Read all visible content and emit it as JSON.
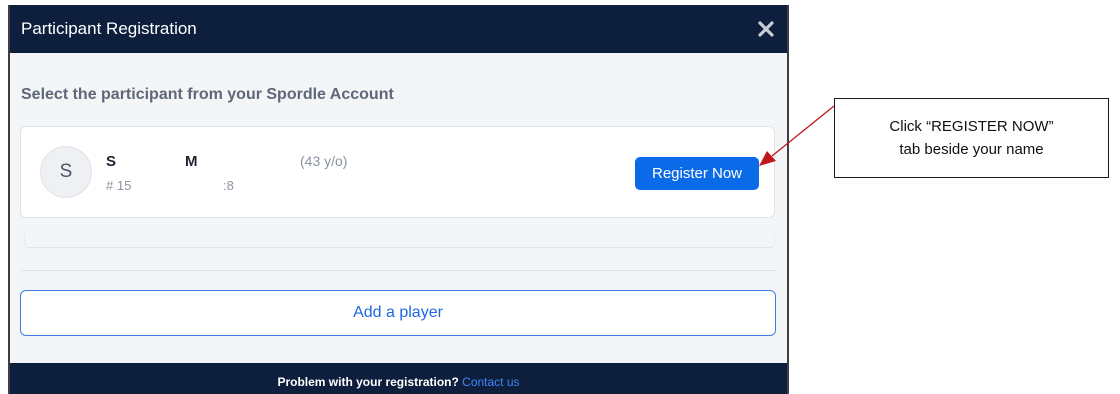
{
  "modal": {
    "title": "Participant Registration",
    "close_icon": "close-icon",
    "prompt": "Select the participant from your Spordle Account",
    "participant": {
      "avatar_initial": "S",
      "first_name": "S",
      "last_name": "M",
      "age": "(43 y/o)",
      "member_prefix": "# 15",
      "member_suffix": ":8",
      "register_label": "Register Now"
    },
    "add_player_label": "Add a player",
    "footer": {
      "text": "Problem with your registration?",
      "link": "Contact us"
    }
  },
  "callout": {
    "line1": "Click “REGISTER NOW”",
    "line2": "tab beside your name"
  },
  "colors": {
    "header_bg": "#0e1f3d",
    "primary": "#0b6ae8",
    "link": "#3f86f5",
    "arrow": "#c0161d"
  }
}
